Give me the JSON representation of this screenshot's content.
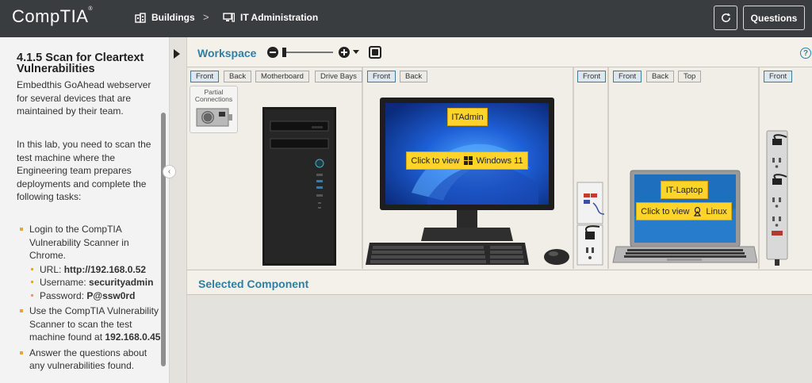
{
  "brand": {
    "logo": "CompTIA"
  },
  "breadcrumb": [
    {
      "label": "Buildings",
      "icon": "buildings-icon"
    },
    {
      "label": "IT Administration",
      "icon": "computer-icon"
    }
  ],
  "breadcrumb_separator": ">",
  "header": {
    "questions_label": "Questions",
    "refresh_icon": "refresh-icon"
  },
  "lab": {
    "title": "4.1.5 Scan for Cleartext Vulnerabilities",
    "intro": "Embedthis GoAhead webserver for several devices that are maintained by their team.",
    "task_intro": "In this lab, you need to scan the test machine where the Engineering team prepares deployments and complete the following tasks:",
    "task1": "Login to the CompTIA Vulnerability Scanner in Chrome.",
    "url_label": "URL: ",
    "url_value": "http://192.168.0.52",
    "user_label": "Username: ",
    "user_value": "securityadmin",
    "pass_label": "Password: ",
    "pass_value": "P@ssw0rd",
    "task2_text": "Use the CompTIA Vulnerability Scanner to scan the test machine found at ",
    "task2_ip": "192.168.0.45",
    "task2_end": ".",
    "task3": "Answer the questions about any vulnerabilities found."
  },
  "workspace": {
    "title": "Workspace",
    "groups": [
      {
        "buttons": [
          "Front",
          "Back",
          "Motherboard",
          "Drive Bays"
        ],
        "active": "Front"
      },
      {
        "buttons": [
          "Front",
          "Back"
        ],
        "active": "Front"
      },
      {
        "buttons": [
          "Front"
        ],
        "active": "Front"
      },
      {
        "buttons": [
          "Front",
          "Back",
          "Top"
        ],
        "active": "Front"
      },
      {
        "buttons": [
          "Front"
        ],
        "active": "Front"
      }
    ],
    "partial_connections": "Partial Connections",
    "monitor_label": "ITAdmin",
    "monitor_link": "Click to view",
    "monitor_os": "Windows 11",
    "laptop_label": "IT-Laptop",
    "laptop_link": "Click to view",
    "laptop_os": "Linux"
  },
  "selected_component": {
    "title": "Selected Component"
  },
  "colors": {
    "accent": "#2f7fa4",
    "topbar": "#3a3d40",
    "badge": "#ffd42a",
    "bullet": "#e8a33a"
  }
}
